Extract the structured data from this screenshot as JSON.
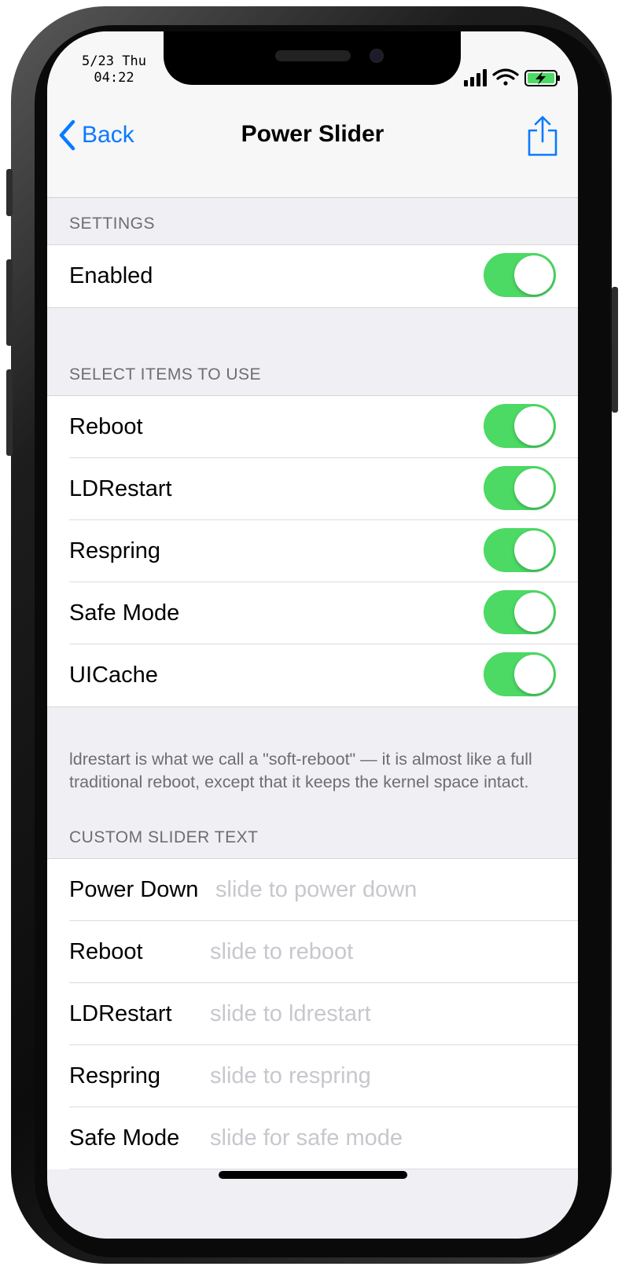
{
  "status_bar": {
    "date": "5/23 Thu",
    "time": "04:22"
  },
  "nav": {
    "back_label": "Back",
    "title": "Power Slider"
  },
  "settings": {
    "header": "SETTINGS",
    "enabled_label": "Enabled",
    "enabled_on": true
  },
  "items": {
    "header": "SELECT ITEMS TO USE",
    "rows": [
      {
        "label": "Reboot",
        "on": true
      },
      {
        "label": "LDRestart",
        "on": true
      },
      {
        "label": "Respring",
        "on": true
      },
      {
        "label": "Safe Mode",
        "on": true
      },
      {
        "label": "UICache",
        "on": true
      }
    ],
    "footer": "ldrestart is what we call a \"soft-reboot\" — it is almost like a full traditional reboot, except that it keeps the kernel space intact."
  },
  "custom_text": {
    "header": "CUSTOM SLIDER TEXT",
    "rows": [
      {
        "label": "Power Down",
        "placeholder": "slide to power down",
        "value": ""
      },
      {
        "label": "Reboot",
        "placeholder": "slide to reboot",
        "value": ""
      },
      {
        "label": "LDRestart",
        "placeholder": "slide to ldrestart",
        "value": ""
      },
      {
        "label": "Respring",
        "placeholder": "slide to respring",
        "value": ""
      },
      {
        "label": "Safe Mode",
        "placeholder": "slide for safe mode",
        "value": ""
      }
    ]
  },
  "colors": {
    "accent": "#0a7aff",
    "toggle_on": "#4cd964",
    "background": "#efeff4"
  },
  "icons": [
    "chevron-left-icon",
    "share-icon",
    "signal-icon",
    "wifi-icon",
    "battery-charging-icon"
  ]
}
